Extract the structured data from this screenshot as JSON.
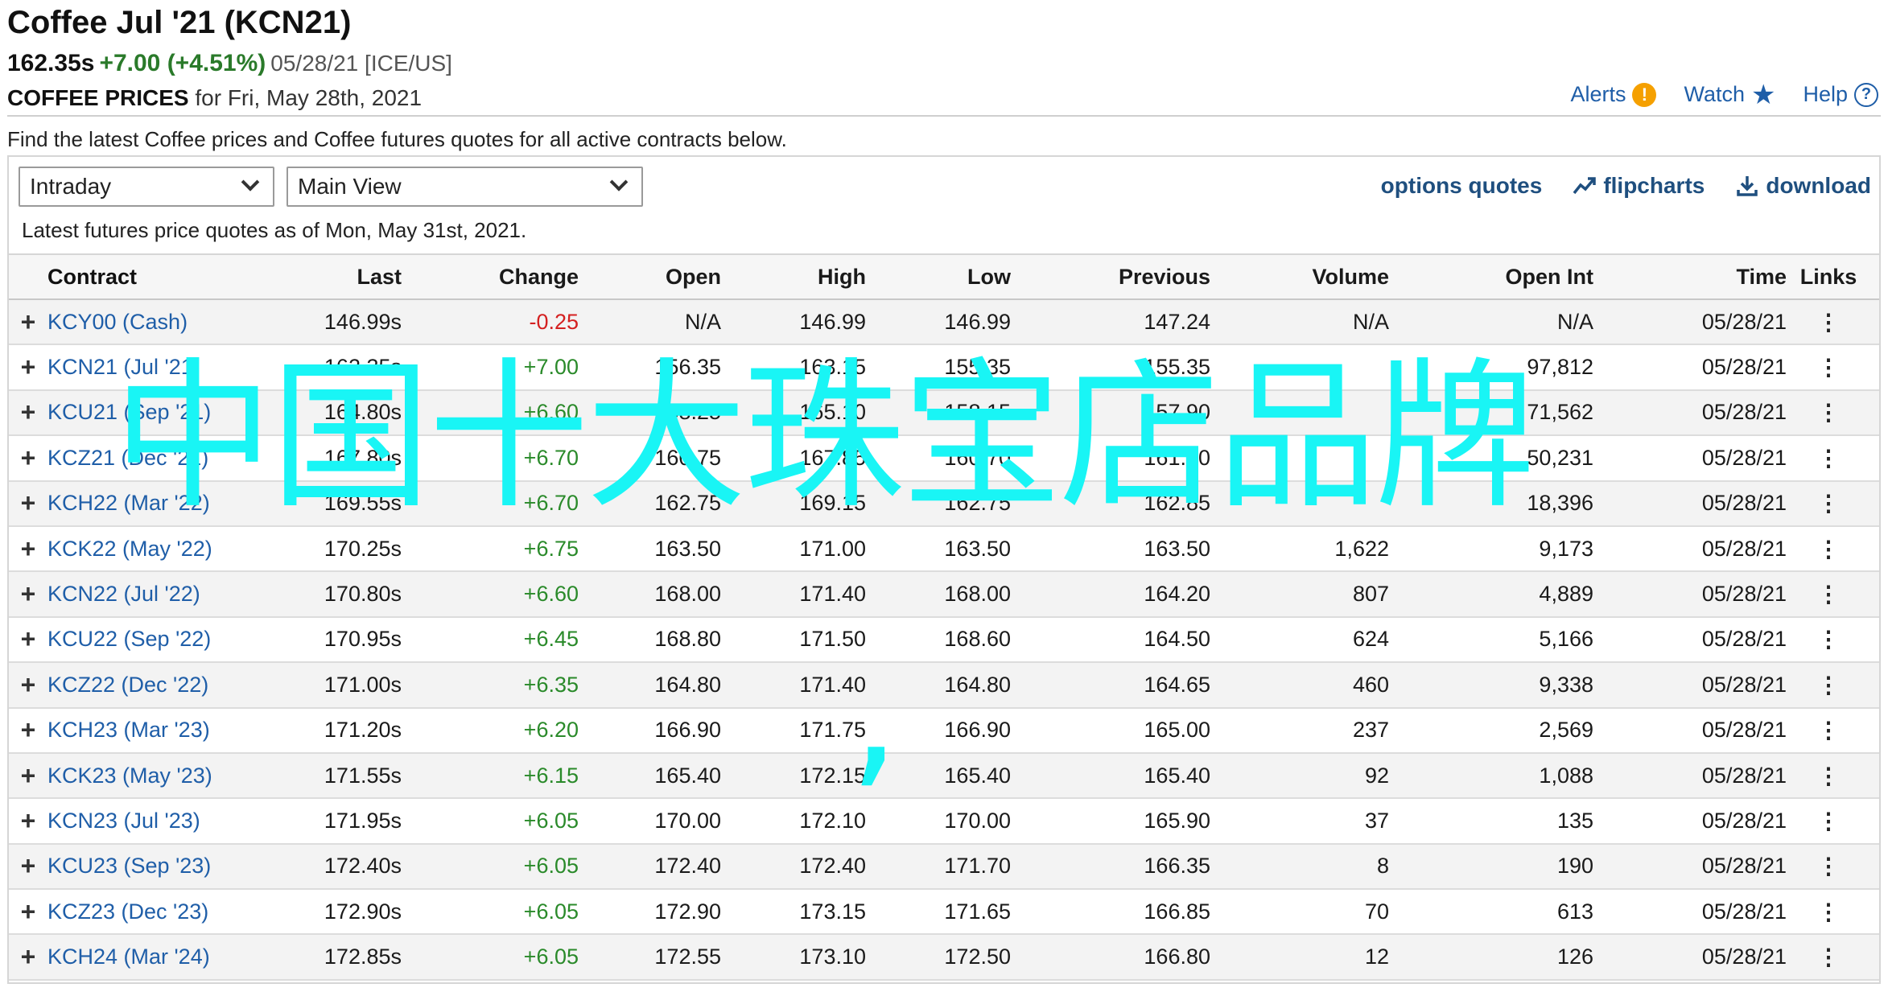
{
  "header": {
    "title": "Coffee Jul '21 (KCN21)",
    "last": "162.35s",
    "change": "+7.00 (+4.51%)",
    "meta": "05/28/21 [ICE/US]",
    "section": "COFFEE PRICES",
    "for_date": "for Fri, May 28th, 2021"
  },
  "actions": {
    "alerts": "Alerts",
    "watch": "Watch",
    "help": "Help"
  },
  "intro": "Find the latest Coffee prices and Coffee futures quotes for all active contracts below.",
  "controls": {
    "period": "Intraday",
    "view": "Main View",
    "options_quotes": "options quotes",
    "flipcharts": "flipcharts",
    "download": "download"
  },
  "asof": "Latest futures price quotes as of Mon, May 31st, 2021.",
  "columns": [
    "Contract",
    "Last",
    "Change",
    "Open",
    "High",
    "Low",
    "Previous",
    "Volume",
    "Open Int",
    "Time",
    "Links"
  ],
  "rows": [
    [
      "KCY00 (Cash)",
      "146.99s",
      "-0.25",
      "N/A",
      "146.99",
      "146.99",
      "147.24",
      "N/A",
      "N/A",
      "05/28/21"
    ],
    [
      "KCN21 (Jul '21)",
      "162.35s",
      "+7.00",
      "156.35",
      "163.15",
      "155.35",
      "155.35",
      "",
      "97,812",
      "05/28/21"
    ],
    [
      "KCU21 (Sep '21)",
      "164.80s",
      "+6.60",
      "158.25",
      "165.10",
      "158.15",
      "157.90",
      "",
      "71,562",
      "05/28/21"
    ],
    [
      "KCZ21 (Dec '21)",
      "167.80s",
      "+6.70",
      "160.75",
      "167.85",
      "160.70",
      "161.10",
      "",
      "50,231",
      "05/28/21"
    ],
    [
      "KCH22 (Mar '22)",
      "169.55s",
      "+6.70",
      "162.75",
      "169.15",
      "162.75",
      "162.85",
      "",
      "18,396",
      "05/28/21"
    ],
    [
      "KCK22 (May '22)",
      "170.25s",
      "+6.75",
      "163.50",
      "171.00",
      "163.50",
      "163.50",
      "1,622",
      "9,173",
      "05/28/21"
    ],
    [
      "KCN22 (Jul '22)",
      "170.80s",
      "+6.60",
      "168.00",
      "171.40",
      "168.00",
      "164.20",
      "807",
      "4,889",
      "05/28/21"
    ],
    [
      "KCU22 (Sep '22)",
      "170.95s",
      "+6.45",
      "168.80",
      "171.50",
      "168.60",
      "164.50",
      "624",
      "5,166",
      "05/28/21"
    ],
    [
      "KCZ22 (Dec '22)",
      "171.00s",
      "+6.35",
      "164.80",
      "171.40",
      "164.80",
      "164.65",
      "460",
      "9,338",
      "05/28/21"
    ],
    [
      "KCH23 (Mar '23)",
      "171.20s",
      "+6.20",
      "166.90",
      "171.75",
      "166.90",
      "165.00",
      "237",
      "2,569",
      "05/28/21"
    ],
    [
      "KCK23 (May '23)",
      "171.55s",
      "+6.15",
      "165.40",
      "172.15",
      "165.40",
      "165.40",
      "92",
      "1,088",
      "05/28/21"
    ],
    [
      "KCN23 (Jul '23)",
      "171.95s",
      "+6.05",
      "170.00",
      "172.10",
      "170.00",
      "165.90",
      "37",
      "135",
      "05/28/21"
    ],
    [
      "KCU23 (Sep '23)",
      "172.40s",
      "+6.05",
      "172.40",
      "172.40",
      "171.70",
      "166.35",
      "8",
      "190",
      "05/28/21"
    ],
    [
      "KCZ23 (Dec '23)",
      "172.90s",
      "+6.05",
      "172.90",
      "173.15",
      "171.65",
      "166.85",
      "70",
      "613",
      "05/28/21"
    ],
    [
      "KCH24 (Mar '24)",
      "172.85s",
      "+6.05",
      "172.55",
      "173.10",
      "172.50",
      "166.80",
      "12",
      "126",
      "05/28/21"
    ]
  ],
  "overlay_text": "中国十大珠宝店品牌",
  "overlay_comma": ",",
  "colors": {
    "link": "#1f5ea8",
    "up": "#2a8a2a",
    "down": "#d42020",
    "overlay": "#19f5f5",
    "alert": "#f5a000"
  }
}
